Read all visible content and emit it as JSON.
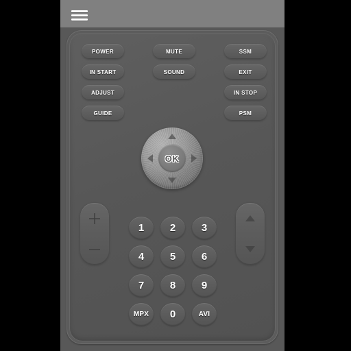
{
  "toolbar": {
    "menu_icon": "hamburger-menu-icon"
  },
  "remote": {
    "function_buttons": [
      {
        "label": "POWER",
        "column": "left",
        "row": 0
      },
      {
        "label": "IN START",
        "column": "left",
        "row": 1
      },
      {
        "label": "ADJUST",
        "column": "left",
        "row": 2
      },
      {
        "label": "GUIDE",
        "column": "left",
        "row": 3
      },
      {
        "label": "MUTE",
        "column": "middle",
        "row": 0
      },
      {
        "label": "SOUND",
        "column": "middle",
        "row": 1
      },
      {
        "label": "SSM",
        "column": "right",
        "row": 0
      },
      {
        "label": "EXIT",
        "column": "right",
        "row": 1
      },
      {
        "label": "IN STOP",
        "column": "right",
        "row": 2
      },
      {
        "label": "PSM",
        "column": "right",
        "row": 3
      }
    ],
    "dpad": {
      "ok_label": "OK",
      "up_icon": "triangle-up-icon",
      "down_icon": "triangle-down-icon",
      "left_icon": "triangle-left-icon",
      "right_icon": "triangle-right-icon"
    },
    "volume_rocker": {
      "up_icon": "plus-icon",
      "down_icon": "minus-icon"
    },
    "channel_rocker": {
      "up_icon": "triangle-up-icon",
      "down_icon": "triangle-down-icon"
    },
    "keypad": [
      {
        "label": "1",
        "row": 0,
        "col": 0
      },
      {
        "label": "2",
        "row": 0,
        "col": 1
      },
      {
        "label": "3",
        "row": 0,
        "col": 2
      },
      {
        "label": "4",
        "row": 1,
        "col": 0
      },
      {
        "label": "5",
        "row": 1,
        "col": 1
      },
      {
        "label": "6",
        "row": 1,
        "col": 2
      },
      {
        "label": "7",
        "row": 2,
        "col": 0
      },
      {
        "label": "8",
        "row": 2,
        "col": 1
      },
      {
        "label": "9",
        "row": 2,
        "col": 2
      },
      {
        "label": "MPX",
        "row": 3,
        "col": 0
      },
      {
        "label": "0",
        "row": 3,
        "col": 1
      },
      {
        "label": "AVI",
        "row": 3,
        "col": 2
      }
    ]
  },
  "colors": {
    "letterbox": "#000000",
    "toolbar": "#808080",
    "remote_body": "#585858",
    "button_face": "#5e5e5e",
    "button_text": "#ffffff",
    "dpad_metal": "#9a9a9a"
  }
}
